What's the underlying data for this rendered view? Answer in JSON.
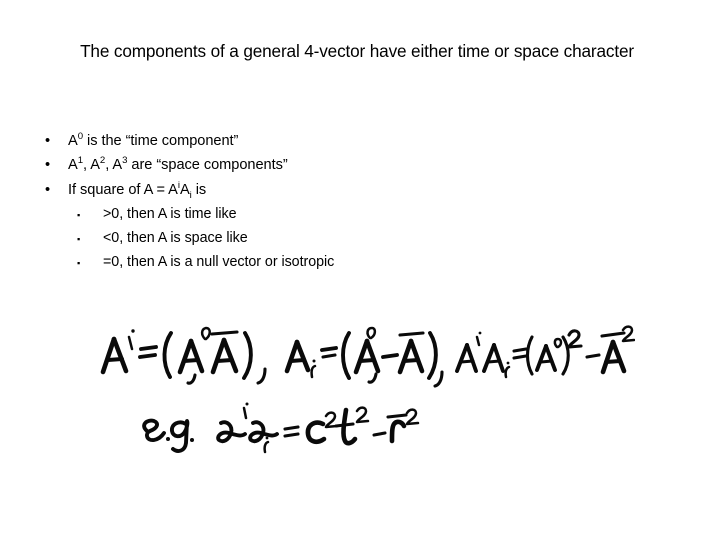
{
  "slide": {
    "background_color": "#ffffff",
    "text_color": "#000000",
    "ink_color": "#0a0a0a"
  },
  "title": {
    "text": "The components of a general 4-vector have either time or space character",
    "line1": "The components of a general 4-vector have either time or space",
    "line2": "character"
  },
  "bullets": {
    "marker_level1": "•",
    "marker_level2": "▪",
    "items": [
      {
        "level": 1,
        "marker": "•",
        "plain": "A0 is the “time component”",
        "parts": [
          {
            "t": "A",
            "style": "normal"
          },
          {
            "t": "0",
            "style": "sup"
          },
          {
            "t": " is the “time component”",
            "style": "normal"
          }
        ]
      },
      {
        "level": 1,
        "marker": "•",
        "plain": "A1, A2, A3 are “space components”",
        "parts": [
          {
            "t": "A",
            "style": "normal"
          },
          {
            "t": "1",
            "style": "sup"
          },
          {
            "t": ", A",
            "style": "normal"
          },
          {
            "t": "2",
            "style": "sup"
          },
          {
            "t": ", A",
            "style": "normal"
          },
          {
            "t": "3",
            "style": "sup"
          },
          {
            "t": " are “space components”",
            "style": "normal"
          }
        ]
      },
      {
        "level": 1,
        "marker": "•",
        "plain": "If square of A = AiAi is",
        "parts": [
          {
            "t": "If square of A = A",
            "style": "normal"
          },
          {
            "t": "i",
            "style": "sup"
          },
          {
            "t": "A",
            "style": "normal"
          },
          {
            "t": "i",
            "style": "sub"
          },
          {
            "t": " is",
            "style": "normal"
          }
        ]
      },
      {
        "level": 2,
        "marker": "▪",
        "plain": ">0, then A is time like",
        "parts": [
          {
            "t": ">0, then A is time like",
            "style": "normal"
          }
        ]
      },
      {
        "level": 2,
        "marker": "▪",
        "plain": "<0, then A is space like",
        "parts": [
          {
            "t": "<0, then A is space like",
            "style": "normal"
          }
        ]
      },
      {
        "level": 2,
        "marker": "▪",
        "plain": "=0, then A is a null vector or isotropic",
        "parts": [
          {
            "t": "=0, then A is a null vector or isotropic",
            "style": "normal"
          }
        ]
      }
    ]
  },
  "handwriting": {
    "description": "handwritten ink annotation of 4-vector component equations",
    "line1": "A^i = (A^0 , A̅) ,  A_i = (A^0 , −A̅) ,  A^i A_i = (A^0)² − A̅²",
    "line2": "e.g.  x^i x_i = c² t² − r̅²",
    "expressions": [
      "A^i = (A^0, vec{A})",
      "A_i = (A^0, -vec{A})",
      "A^i A_i = (A^0)^2 - vec{A}^2",
      "e.g. x^i x_i = c^2 t^2 - vec{r}^2"
    ]
  }
}
